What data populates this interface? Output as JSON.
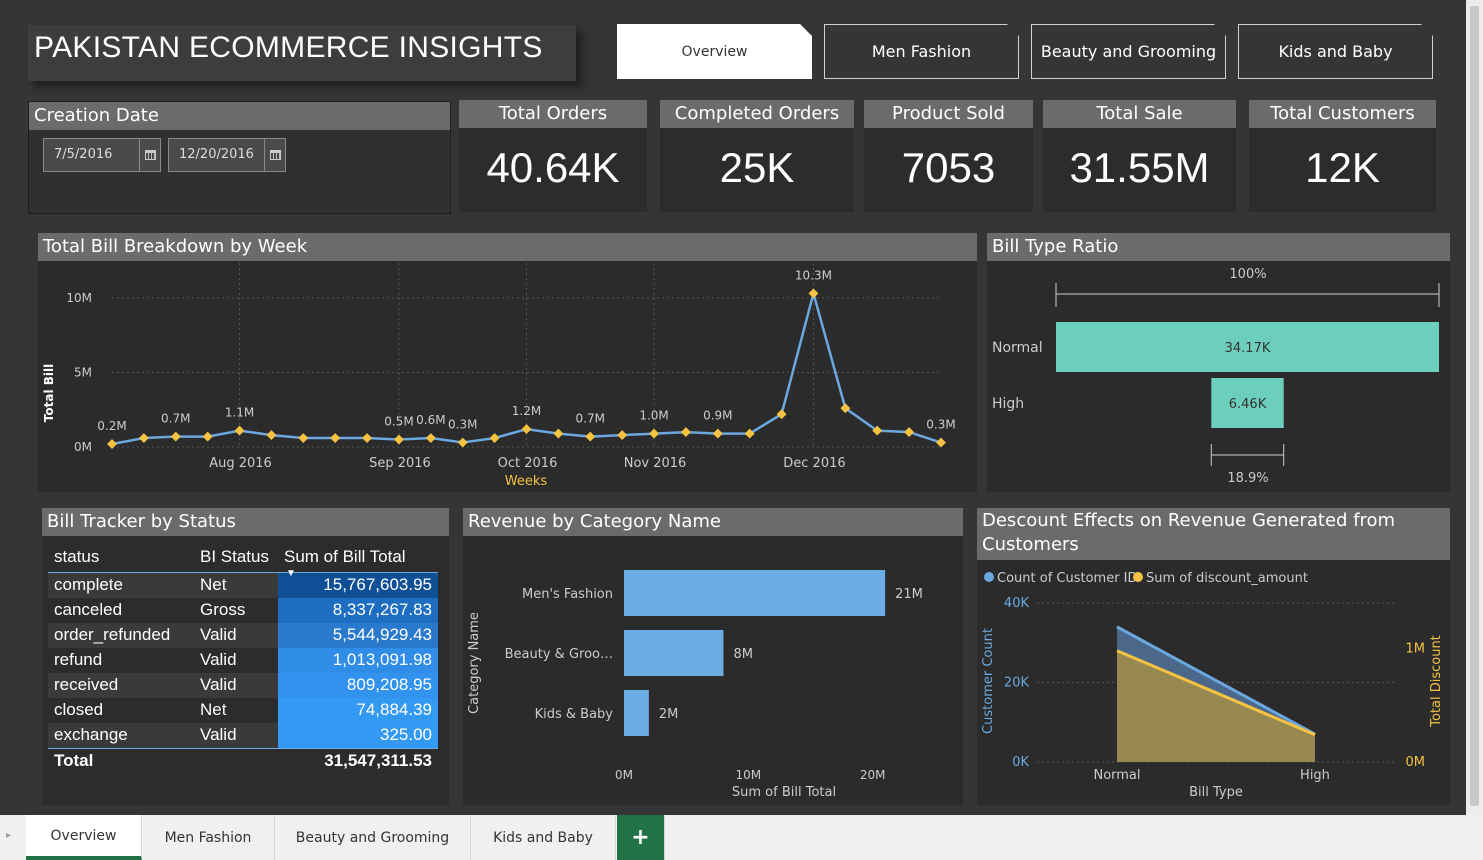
{
  "app": {
    "title": "PAKISTAN ECOMMERCE INSIGHTS",
    "nav": [
      {
        "label": "Overview"
      },
      {
        "label": "Men Fashion"
      },
      {
        "label": "Beauty and Grooming"
      },
      {
        "label": "Kids and Baby"
      }
    ]
  },
  "filter": {
    "title": "Creation Date",
    "start": "7/5/2016",
    "end": "12/20/2016"
  },
  "kpis": [
    {
      "label": "Total Orders",
      "value": "40.64K"
    },
    {
      "label": "Completed Orders",
      "value": "25K"
    },
    {
      "label": "Product Sold",
      "value": "7053"
    },
    {
      "label": "Total Sale",
      "value": "31.55M"
    },
    {
      "label": "Total Customers",
      "value": "12K"
    }
  ],
  "chart_data": [
    {
      "type": "line",
      "title": "Total Bill Breakdown by Week",
      "xlabel": "Weeks",
      "ylabel": "Total Bill",
      "ylim": [
        0,
        11000000
      ],
      "yticks": [
        "0M",
        "5M",
        "10M"
      ],
      "xticks": [
        "Aug 2016",
        "Sep 2016",
        "Oct 2016",
        "Nov 2016",
        "Dec 2016"
      ],
      "series": [
        {
          "values": [
            0.2,
            0.6,
            0.7,
            0.7,
            1.1,
            0.8,
            0.6,
            0.6,
            0.6,
            0.5,
            0.6,
            0.3,
            0.6,
            1.2,
            0.9,
            0.7,
            0.8,
            0.9,
            1.0,
            0.9,
            0.9,
            2.2,
            10.3,
            2.6,
            1.1,
            1.0,
            0.3
          ]
        }
      ],
      "value_unit": "M",
      "data_labels": [
        {
          "i": 0,
          "text": "0.2M"
        },
        {
          "i": 2,
          "text": "0.7M"
        },
        {
          "i": 4,
          "text": "1.1M"
        },
        {
          "i": 9,
          "text": "0.5M"
        },
        {
          "i": 10,
          "text": "0.6M"
        },
        {
          "i": 11,
          "text": "0.3M"
        },
        {
          "i": 13,
          "text": "1.2M"
        },
        {
          "i": 15,
          "text": "0.7M"
        },
        {
          "i": 17,
          "text": "1.0M"
        },
        {
          "i": 19,
          "text": "0.9M"
        },
        {
          "i": 22,
          "text": "10.3M"
        },
        {
          "i": 26,
          "text": "0.3M"
        }
      ],
      "colors": {
        "line": "#6aa9e0",
        "marker": "#f5c242",
        "axis_title": "#f5c242"
      }
    },
    {
      "type": "bar",
      "title": "Bill Type Ratio",
      "categories": [
        "Normal",
        "High"
      ],
      "values": [
        34.17,
        6.46
      ],
      "labels": [
        "34.17K",
        "6.46K"
      ],
      "top_label": "100%",
      "bottom_label": "18.9%",
      "colors": {
        "bar": "#6ccfbd"
      }
    },
    {
      "type": "table",
      "title": "Bill Tracker by Status",
      "columns": [
        "status",
        "BI Status",
        "Sum of Bill Total"
      ],
      "rows": [
        [
          "complete",
          "Net",
          "15,767,603.95"
        ],
        [
          "canceled",
          "Gross",
          "8,337,267.83"
        ],
        [
          "order_refunded",
          "Valid",
          "5,544,929.43"
        ],
        [
          "refund",
          "Valid",
          "1,013,091.98"
        ],
        [
          "received",
          "Valid",
          "809,208.95"
        ],
        [
          "closed",
          "Net",
          "74,884.39"
        ],
        [
          "exchange",
          "Valid",
          "325.00"
        ]
      ],
      "total": [
        "Total",
        "",
        "31,547,311.53"
      ],
      "cell_colors": [
        "#0f4f96",
        "#1d6dc0",
        "#2979cc",
        "#2f8de8",
        "#3193ee",
        "#3399f2",
        "#3399f2"
      ]
    },
    {
      "type": "bar",
      "title": "Revenue by Category Name",
      "orientation": "horizontal",
      "categories": [
        "Men's Fashion",
        "Beauty & Groo…",
        "Kids & Baby"
      ],
      "values": [
        21,
        8,
        2
      ],
      "labels": [
        "21M",
        "8M",
        "2M"
      ],
      "xlabel": "Sum of Bill Total",
      "ylabel": "Category Name",
      "xlim": [
        0,
        23
      ],
      "xticks": [
        "0M",
        "10M",
        "20M"
      ],
      "colors": {
        "bar": "#6cace4"
      }
    },
    {
      "type": "area",
      "title": "Descount Effects on Revenue Generated from Customers",
      "categories": [
        "Normal",
        "High"
      ],
      "xlabel": "Bill Type",
      "ylabel": "Customer Count",
      "y2label": "Total Discount",
      "ylim": [
        0,
        40000
      ],
      "y2lim": [
        0,
        1400000
      ],
      "yticks": [
        "0K",
        "20K",
        "40K"
      ],
      "y2ticks": [
        "0M",
        "1M"
      ],
      "series": [
        {
          "name": "Count of Customer ID",
          "values": [
            34000,
            7000
          ],
          "color": "#6aa9e0"
        },
        {
          "name": "Sum of discount_amount",
          "values": [
            980000,
            240000
          ],
          "color": "#f5c242"
        }
      ]
    }
  ],
  "sheet_tabs": {
    "tabs": [
      {
        "label": "Overview"
      },
      {
        "label": "Men Fashion"
      },
      {
        "label": "Beauty and Grooming"
      },
      {
        "label": "Kids and Baby"
      }
    ],
    "add": "+"
  }
}
